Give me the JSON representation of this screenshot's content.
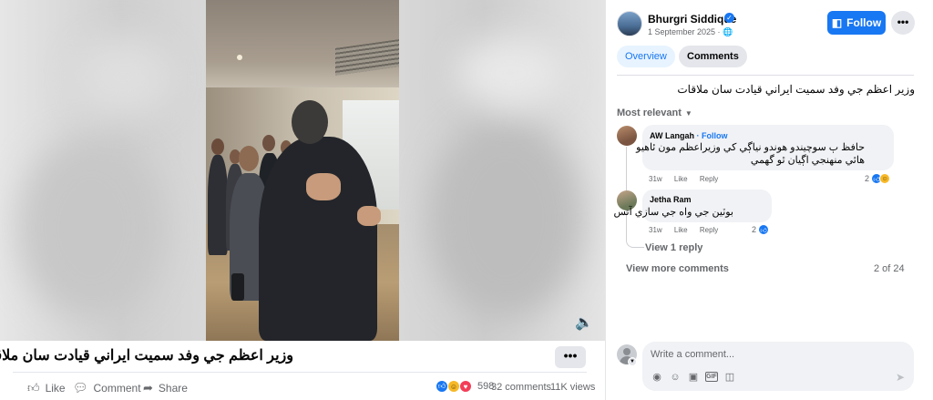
{
  "post": {
    "caption": "وزير اعظم جي وفد سميت ايراني قيادت سان ملاقات",
    "more_label": "•••",
    "actions": {
      "like": "Like",
      "comment": "Comment",
      "share": "Share"
    },
    "reaction_count": "598",
    "comment_count": "32 comments",
    "view_count": "11K views"
  },
  "panel": {
    "author_name": "Bhurgri Siddique",
    "verified_glyph": "✓",
    "date": "1 September 2025 · 🌐",
    "follow_label": "Follow",
    "more_label": "•••",
    "tabs": {
      "overview": "Overview",
      "comments": "Comments"
    },
    "post_text": "وزير اعظم جي وفد سميت ايراني قيادت سان ملاقات",
    "sort_label": "Most relevant",
    "comments": [
      {
        "author": "AW Langah",
        "follow": " · Follow",
        "text_line1": "حافظ ٻ سوچيندو هوندو نياڳي کي وزيراعظم مون ئاهيو",
        "text_line2": "هائي منهنجي اڳيان ٿو گهمي",
        "time": "31w",
        "like": "Like",
        "reply": "Reply",
        "reaction_count": "2"
      },
      {
        "author": "Jetha Ram",
        "text_line1": "بوٽين جي واه جي سازي آتس",
        "time": "31w",
        "like": "Like",
        "reply": "Reply",
        "reaction_count": "2"
      }
    ],
    "view_reply": "View 1 reply",
    "view_more": "View more comments",
    "pagination": "2 of 24",
    "composer_placeholder": "Write a comment..."
  },
  "colors": {
    "accent": "#1877f2",
    "secondary_text": "#65676b",
    "bubble": "#f0f2f5"
  },
  "icons": [
    "speaker-icon",
    "like-icon",
    "comment-icon",
    "share-icon",
    "globe-icon",
    "verified-icon",
    "follow-icon",
    "emoji-icon",
    "camera-icon",
    "gif-icon",
    "sticker-icon",
    "send-icon"
  ]
}
